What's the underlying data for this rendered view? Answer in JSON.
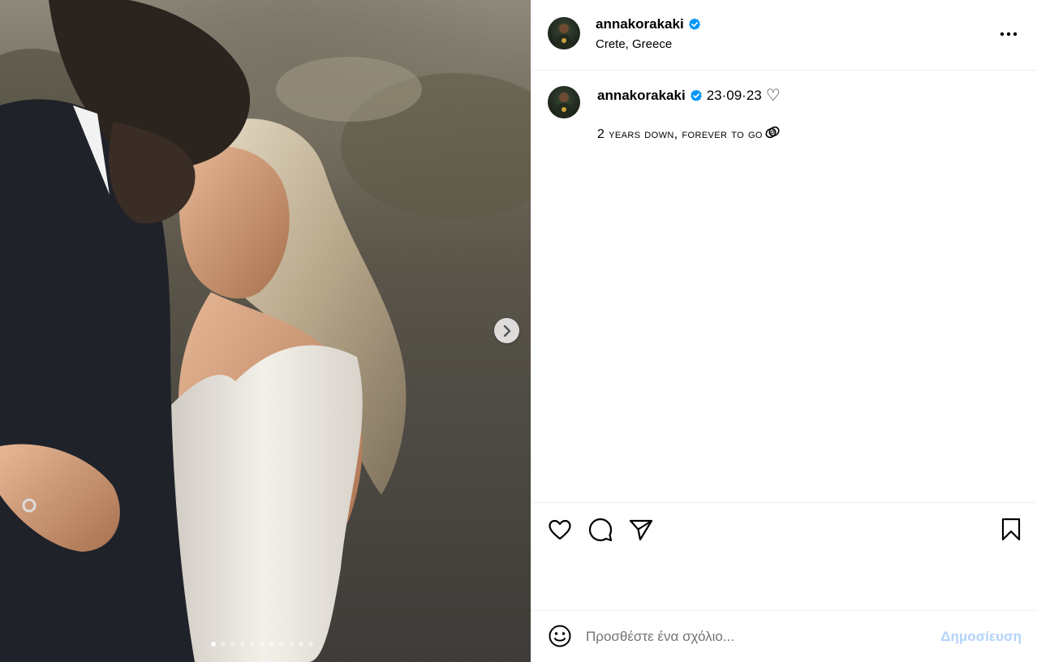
{
  "post": {
    "image_alt": "Couple embracing at sunset",
    "carousel": {
      "total": 11,
      "active_index": 0
    }
  },
  "header": {
    "username": "annakorakaki",
    "location": "Crete, Greece",
    "verified_icon": "verified-badge-icon",
    "more_icon": "more-horizontal-icon"
  },
  "caption": {
    "username": "annakorakaki",
    "date": "23·09·23",
    "date_emoji": "♡",
    "text": "2 years down, forever to go"
  },
  "actions": {
    "like_icon": "heart-icon",
    "comment_icon": "comment-icon",
    "share_icon": "send-icon",
    "save_icon": "bookmark-icon"
  },
  "comment": {
    "placeholder": "Προσθέστε ένα σχόλιο...",
    "post_label": "Δημοσίευση"
  },
  "colors": {
    "verified": "#0095f6",
    "post_button_disabled": "#b2d3fb",
    "divider": "#efefef"
  }
}
